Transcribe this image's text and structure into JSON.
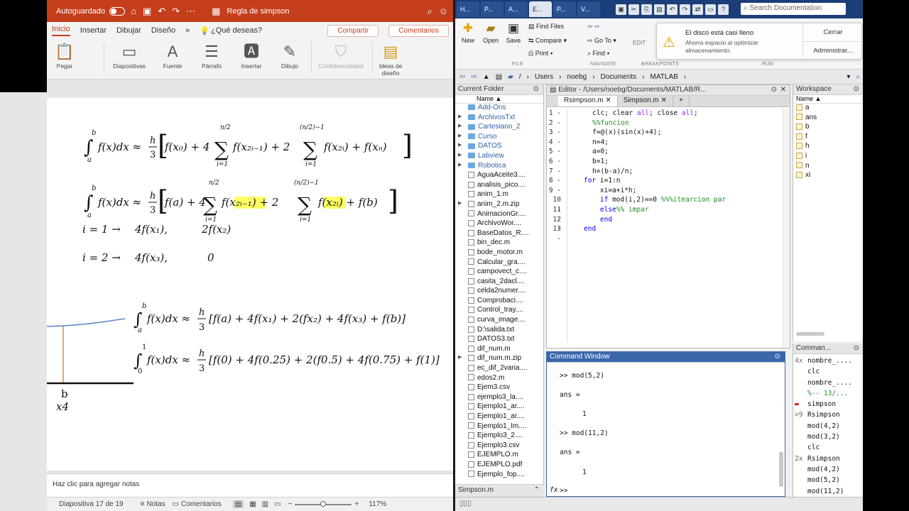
{
  "ppt": {
    "autosave_label": "Autoguardado",
    "doc_title": "Regla de simpson",
    "tabs": [
      "Inicio",
      "Insertar",
      "Dibujar",
      "Diseño"
    ],
    "tell_me": "¿Qué deseas?",
    "share": "Compartir",
    "comments": "Comentarios",
    "ribbon": {
      "pegar": "Pegar",
      "diapositivas": "Diapositivas",
      "fuente": "Fuente",
      "parrafo": "Párrafo",
      "insertar": "Insertar",
      "dibujo": "Dibujo",
      "confidencialidad": "Confidencialidad",
      "ideas": "Ideas de diseño"
    },
    "slide": {
      "i1_label": "i = 1 →",
      "i1_a": "4f(x₁),",
      "i1_b": "2f(x₂)",
      "i2_label": "i = 2 →",
      "i2_a": "4f(x₃),",
      "i2_b": "0",
      "b_label": "b",
      "x4_label": "x4"
    },
    "notes_placeholder": "Haz clic para agregar notas",
    "status": {
      "slide_of": "Diapositiva 17 de 19",
      "notas": "Notas",
      "comentarios": "Comentarios",
      "zoom": "117%"
    }
  },
  "matlab": {
    "tabs": [
      "H...",
      "P...",
      "A...",
      "E...",
      "P...",
      "V..."
    ],
    "search_placeholder": "Search Documentation",
    "toolbar": {
      "new": "New",
      "open": "Open",
      "save": "Save",
      "find_files": "Find Files",
      "compare": "Compare",
      "print": "Print",
      "go_to": "Go To",
      "find": "Find",
      "edit": "EDIT",
      "file": "FILE",
      "navigate": "NAVIGATE",
      "breakpoints": "BREAKPOINTS",
      "run": "RUN"
    },
    "notification": {
      "title": "El disco está casi lleno",
      "body": "Ahorra espacio al optimizar almacenamiento.",
      "close": "Cerrar",
      "manage": "Administrar..."
    },
    "path": [
      "/",
      "Users",
      "noebg",
      "Documents",
      "MATLAB"
    ],
    "current_folder": {
      "title": "Current Folder",
      "column": "Name ▲",
      "items": [
        {
          "name": "Add-Ons",
          "type": "folder"
        },
        {
          "name": "ArchivosTxt",
          "type": "folder",
          "arrow": true
        },
        {
          "name": "Cartesiano_2",
          "type": "folder",
          "arrow": true
        },
        {
          "name": "Curso",
          "type": "folder",
          "arrow": true
        },
        {
          "name": "DATOS",
          "type": "folder",
          "arrow": true
        },
        {
          "name": "Labview",
          "type": "folder",
          "arrow": true
        },
        {
          "name": "Robotica",
          "type": "folder",
          "arrow": true
        },
        {
          "name": "AguaAceite3....",
          "type": "file"
        },
        {
          "name": "analisis_pico....",
          "type": "file"
        },
        {
          "name": "anim_1.m",
          "type": "file"
        },
        {
          "name": "anim_2.m.zip",
          "type": "file",
          "arrow": true
        },
        {
          "name": "AnimacionGr....",
          "type": "file"
        },
        {
          "name": "ArchivoWor....",
          "type": "file"
        },
        {
          "name": "BaseDatos_R....",
          "type": "file"
        },
        {
          "name": "bin_dec.m",
          "type": "file"
        },
        {
          "name": "bode_motor.m",
          "type": "file"
        },
        {
          "name": "Calcular_gra....",
          "type": "file"
        },
        {
          "name": "campovect_c....",
          "type": "file"
        },
        {
          "name": "casita_2dacl....",
          "type": "file"
        },
        {
          "name": "celda2numer....",
          "type": "file"
        },
        {
          "name": "Comprobaci....",
          "type": "file"
        },
        {
          "name": "Control_tray....",
          "type": "file"
        },
        {
          "name": "curva_image....",
          "type": "file"
        },
        {
          "name": "D:\\salida.txt",
          "type": "file"
        },
        {
          "name": "DATOS3.txt",
          "type": "file"
        },
        {
          "name": "dif_num.m",
          "type": "file"
        },
        {
          "name": "dif_num.m.zip",
          "type": "file",
          "arrow": true
        },
        {
          "name": "ec_dif_2varia....",
          "type": "file"
        },
        {
          "name": "edos2.m",
          "type": "file"
        },
        {
          "name": "Ejem3.csv",
          "type": "file"
        },
        {
          "name": "ejemplo3_la....",
          "type": "file"
        },
        {
          "name": "Ejemplo1_ar....",
          "type": "file"
        },
        {
          "name": "Ejemplo1_ar....",
          "type": "file"
        },
        {
          "name": "Ejemplo1_Im....",
          "type": "file"
        },
        {
          "name": "Ejemplo3_2....",
          "type": "file"
        },
        {
          "name": "Ejemplo3.csv",
          "type": "file"
        },
        {
          "name": "EJEMPLO.m",
          "type": "file"
        },
        {
          "name": "EJEMPLO.pdf",
          "type": "file"
        },
        {
          "name": "Ejemplo_fop....",
          "type": "file"
        }
      ],
      "footer": "Simpson.m"
    },
    "editor": {
      "title": "Editor - /Users/noebg/Documents/MATLAB/R...",
      "tabs": [
        "Rsimpson.m",
        "Simpson.m"
      ],
      "lines": [
        "clc; clear all; close all;",
        "%%funcion",
        "f=@(x)(sin(x)+4);",
        "n=4;",
        "a=0;",
        "b=1;",
        "h=(b-a)/n;",
        "for i=1:n",
        "    xi=a+i*h;",
        "    if mod(i,2)==0 %%%itearcion par",
        "    else%% impar",
        "    end",
        "end"
      ]
    },
    "command_window": {
      "title": "Command Window",
      "lines": [
        ">> mod(5,2)",
        "ans =",
        "1",
        ">> mod(11,2)",
        "ans =",
        "1"
      ],
      "prompt": ">>"
    },
    "workspace": {
      "title": "Workspace",
      "column": "Name ▲",
      "vars": [
        "a",
        "ans",
        "b",
        "f",
        "h",
        "i",
        "n",
        "xi"
      ]
    },
    "history": {
      "title": "Comman...",
      "rows": [
        {
          "mark": "4x",
          "text": "nombre_...."
        },
        {
          "mark": "",
          "text": "clc"
        },
        {
          "mark": "",
          "text": "nombre_...."
        },
        {
          "mark": "",
          "text": "%-- 13/..."
        },
        {
          "mark": "▬",
          "text": "simpson"
        },
        {
          "mark": ">9",
          "text": "Rsimpson"
        },
        {
          "mark": "",
          "text": "mod(4,2)"
        },
        {
          "mark": "",
          "text": "mod(3,2)"
        },
        {
          "mark": "",
          "text": "clc"
        },
        {
          "mark": "2x",
          "text": "Rsimpson"
        },
        {
          "mark": "",
          "text": "mod(4,2)"
        },
        {
          "mark": "",
          "text": "mod(5,2)"
        },
        {
          "mark": "",
          "text": "mod(11,2)"
        }
      ]
    }
  },
  "colors": {
    "ppt_accent": "#c43e1c",
    "matlab_blue": "#3a67aa",
    "keyword": "#0000ff",
    "comment": "#228b22",
    "highlight": "#ffff66"
  }
}
